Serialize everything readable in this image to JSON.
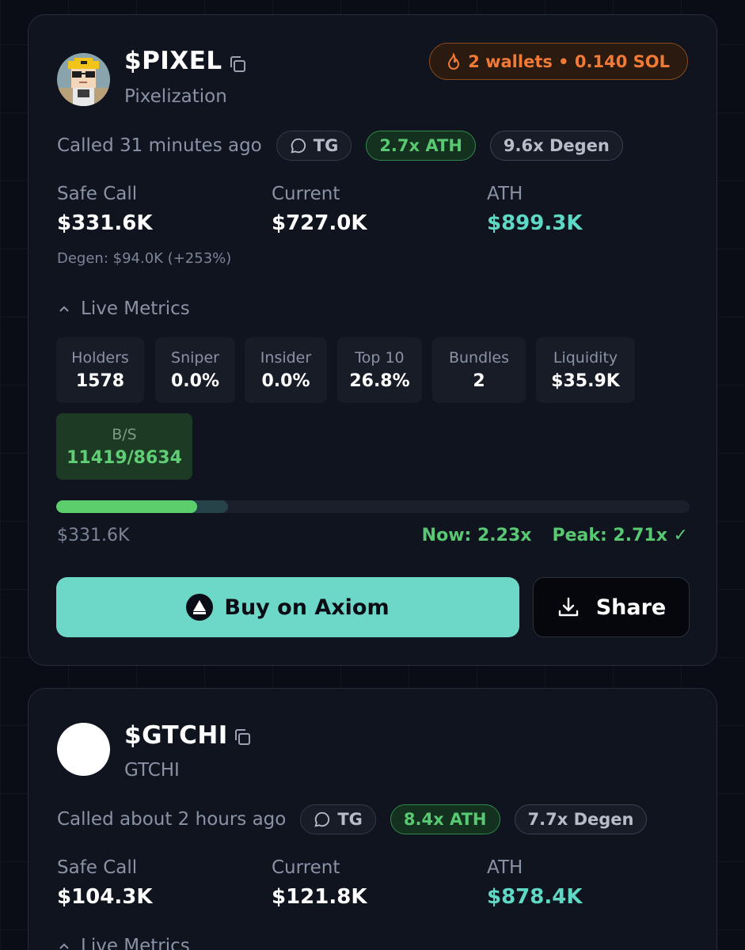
{
  "cards": [
    {
      "ticker": "$PIXEL",
      "name": "Pixelization",
      "avatar": "pixel-character-icon",
      "wallet_badge": {
        "text": "2 wallets • 0.140 SOL",
        "icon": "fire-icon"
      },
      "called": "Called 31 minutes ago",
      "tags": {
        "tg": "TG",
        "ath": "2.7x ATH",
        "degen": "9.6x Degen"
      },
      "stats": {
        "safe_call_label": "Safe Call",
        "safe_call": "$331.6K",
        "current_label": "Current",
        "current": "$727.0K",
        "ath_label": "ATH",
        "ath": "$899.3K",
        "degen_line": "Degen: $94.0K (+253%)"
      },
      "metrics_toggle": "Live Metrics",
      "metrics": [
        {
          "label": "Holders",
          "value": "1578"
        },
        {
          "label": "Sniper",
          "value": "0.0%"
        },
        {
          "label": "Insider",
          "value": "0.0%"
        },
        {
          "label": "Top 10",
          "value": "26.8%"
        },
        {
          "label": "Bundles",
          "value": "2"
        },
        {
          "label": "Liquidity",
          "value": "$35.9K"
        }
      ],
      "bs": {
        "label": "B/S",
        "value": "11419/8634"
      },
      "progress": {
        "now_fraction": 0.223,
        "peak_fraction": 0.271
      },
      "entry_value": "$331.6K",
      "now": "Now: 2.23x",
      "peak": "Peak: 2.71x ✓",
      "buy_label": "Buy on Axiom",
      "share_label": "Share"
    },
    {
      "ticker": "$GTCHI",
      "name": "GTCHI",
      "called": "Called about 2 hours ago",
      "tags": {
        "tg": "TG",
        "ath": "8.4x ATH",
        "degen": "7.7x Degen"
      },
      "stats": {
        "safe_call_label": "Safe Call",
        "safe_call": "$104.3K",
        "current_label": "Current",
        "current": "$121.8K",
        "ath_label": "ATH",
        "ath": "$878.4K"
      },
      "metrics_toggle": "Live Metrics"
    }
  ],
  "colors": {
    "background": "#0a0d15",
    "card": "#0f141f",
    "accent_teal": "#6ed8c8",
    "green": "#58c872",
    "orange": "#f07a36"
  }
}
